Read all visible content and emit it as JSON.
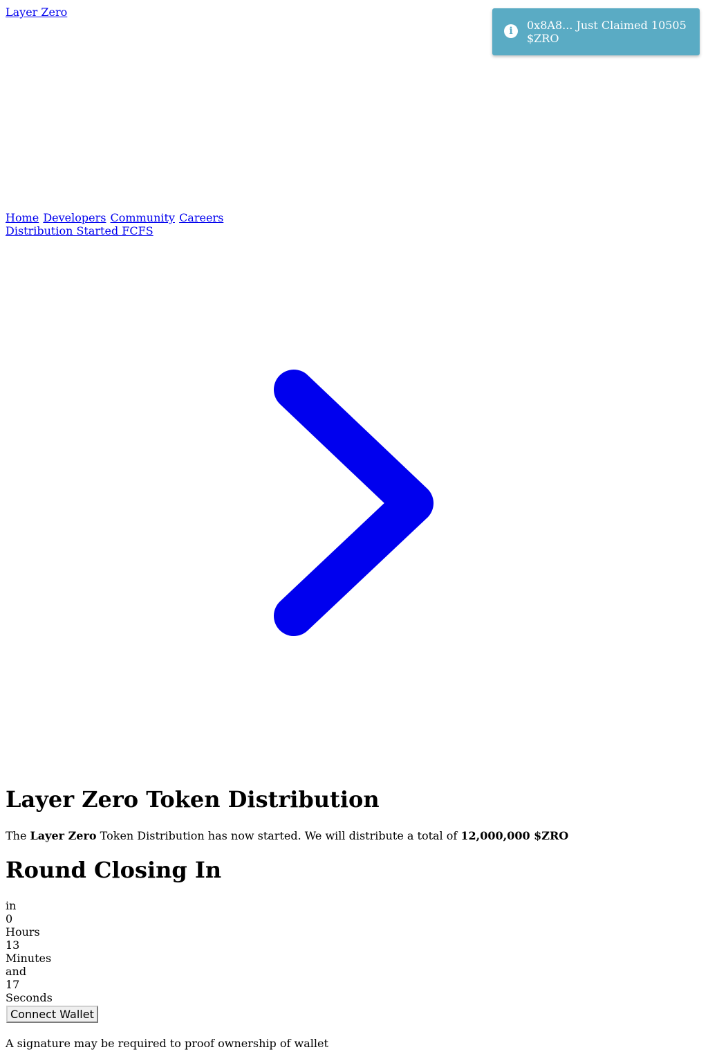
{
  "header": {
    "logo_text": "Layer Zero"
  },
  "nav": {
    "items": [
      {
        "label": "Home"
      },
      {
        "label": "Developers"
      },
      {
        "label": "Community"
      },
      {
        "label": "Careers"
      }
    ],
    "distribution_link": "Distribution Started FCFS"
  },
  "hero": {
    "icon": "chevron-right-icon",
    "icon_color": "#0000ee"
  },
  "main": {
    "title": "Layer Zero Token Distribution",
    "intro_prefix": "The ",
    "intro_brand": "Layer Zero",
    "intro_middle": " Token Distribution has now started. We will distribute a total of ",
    "intro_amount": "12,000,000 $ZRO",
    "round_title": "Round Closing In"
  },
  "countdown": {
    "in_label": "in",
    "hours_value": "0",
    "hours_label": "Hours",
    "minutes_value": "13",
    "minutes_label": "Minutes",
    "and_label": "and",
    "seconds_value": "17",
    "seconds_label": "Seconds"
  },
  "actions": {
    "connect_label": "Connect Wallet",
    "signature_note": "A signature may be required to proof ownership of wallet"
  },
  "toast": {
    "icon": "info-icon",
    "icon_glyph": "i",
    "message": "0x8A8... Just Claimed 10505 $ZRO",
    "color": "#5aabc4"
  }
}
